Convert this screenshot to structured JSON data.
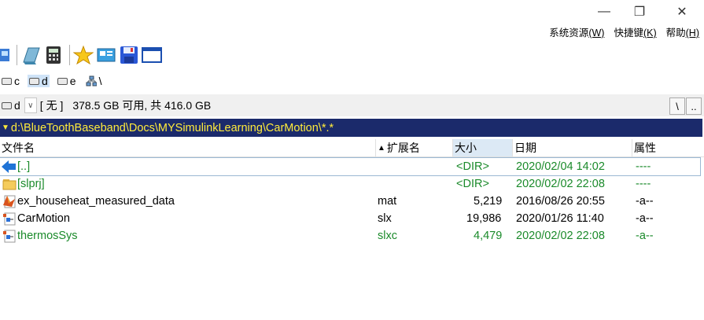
{
  "window": {
    "controls": {
      "minimize": "—",
      "restore": "❐",
      "close": "✕"
    }
  },
  "menubar": [
    {
      "label": "系统资源",
      "key": "(W)"
    },
    {
      "label": "快捷键",
      "key": "(K)"
    },
    {
      "label": "帮助",
      "key": "(H)"
    }
  ],
  "toolbar": {
    "icons": [
      "ftp-icon",
      "notepad-icon",
      "calculator-icon",
      "favorite-star-icon",
      "network-icon",
      "save-disk-icon",
      "window-icon"
    ]
  },
  "drives": [
    {
      "label": "c",
      "active": false
    },
    {
      "label": "d",
      "active": true
    },
    {
      "label": "e",
      "active": false
    },
    {
      "label": "\\",
      "active": false
    }
  ],
  "current_drive": {
    "letter": "d",
    "label": "[ 无 ]",
    "space": "378.5 GB 可用, 共 416.0 GB",
    "root_btn": "\\",
    "up_btn": ".."
  },
  "path": "d:\\BlueToothBaseband\\Docs\\MYSimulinkLearning\\CarMotion\\*.*",
  "columns": {
    "name": "文件名",
    "ext": "扩展名",
    "size": "大小",
    "date": "日期",
    "attr": "属性"
  },
  "files": [
    {
      "name": "[..]",
      "ext": "",
      "size": "<DIR>",
      "date": "2020/02/04 14:02",
      "attr": "----",
      "color": "green",
      "icon": "up-arrow-icon"
    },
    {
      "name": "[slprj]",
      "ext": "",
      "size": "<DIR>",
      "date": "2020/02/02 22:08",
      "attr": "----",
      "color": "green",
      "icon": "folder-icon"
    },
    {
      "name": "ex_househeat_measured_data",
      "ext": "mat",
      "size": "5,219",
      "date": "2016/08/26 20:55",
      "attr": "-a--",
      "color": "black",
      "icon": "matlab-icon"
    },
    {
      "name": "CarMotion",
      "ext": "slx",
      "size": "19,986",
      "date": "2020/01/26 11:40",
      "attr": "-a--",
      "color": "black",
      "icon": "simulink-icon"
    },
    {
      "name": "thermosSys",
      "ext": "slxc",
      "size": "4,479",
      "date": "2020/02/02 22:08",
      "attr": "-a--",
      "color": "green",
      "icon": "simulink-cache-icon"
    }
  ]
}
